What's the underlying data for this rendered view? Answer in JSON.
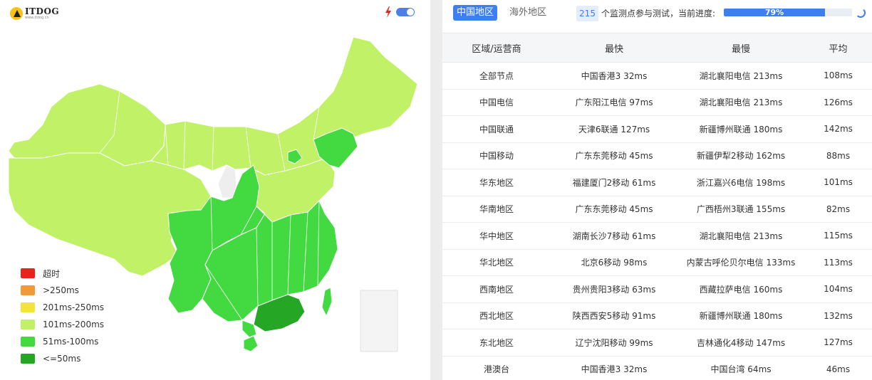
{
  "logo": {
    "title": "ITDOG",
    "subtitle": "www.itdog.cn"
  },
  "icons": {
    "flash": "flash-icon",
    "toggle": "toggle-switch",
    "spinner": "loading-spinner"
  },
  "colors": {
    "timeout": "#e8231c",
    "over250": "#f39a38",
    "r201_250": "#f3e43d",
    "r101_200": "#c0f166",
    "r51_100": "#43d940",
    "le50": "#25a725",
    "nodata": "#eeeeee",
    "accent": "#3d7ef0"
  },
  "legend": [
    {
      "label": "超时",
      "color": "#e8231c"
    },
    {
      "label": ">250ms",
      "color": "#f39a38"
    },
    {
      "label": "201ms-250ms",
      "color": "#f3e43d"
    },
    {
      "label": "101ms-200ms",
      "color": "#c0f166"
    },
    {
      "label": "51ms-100ms",
      "color": "#43d940"
    },
    {
      "label": "<=50ms",
      "color": "#25a725"
    }
  ],
  "tabs": {
    "china": "中国地区",
    "overseas": "海外地区"
  },
  "progress": {
    "count": "215",
    "text": "个监测点参与测试，当前进度:",
    "percent_label": "79%",
    "percent": 79
  },
  "table": {
    "headers": [
      "区域/运营商",
      "最快",
      "最慢",
      "平均"
    ],
    "rows": [
      [
        "全部节点",
        "中国香港3 32ms",
        "湖北襄阳电信 213ms",
        "108ms"
      ],
      [
        "中国电信",
        "广东阳江电信 97ms",
        "湖北襄阳电信 213ms",
        "126ms"
      ],
      [
        "中国联通",
        "天津6联通 127ms",
        "新疆博州联通 180ms",
        "142ms"
      ],
      [
        "中国移动",
        "广东东莞移动 45ms",
        "新疆伊犁2移动 162ms",
        "88ms"
      ],
      [
        "华东地区",
        "福建厦门2移动 61ms",
        "浙江嘉兴6电信 198ms",
        "101ms"
      ],
      [
        "华南地区",
        "广东东莞移动 45ms",
        "广西梧州3联通 155ms",
        "82ms"
      ],
      [
        "华中地区",
        "湖南长沙7移动 61ms",
        "湖北襄阳电信 213ms",
        "115ms"
      ],
      [
        "华北地区",
        "北京6移动 98ms",
        "内蒙古呼伦贝尔电信 133ms",
        "113ms"
      ],
      [
        "西南地区",
        "贵州贵阳3移动 63ms",
        "西藏拉萨电信 160ms",
        "104ms"
      ],
      [
        "西北地区",
        "陕西西安5移动 91ms",
        "新疆博州联通 180ms",
        "132ms"
      ],
      [
        "东北地区",
        "辽宁沈阳移动 99ms",
        "吉林通化4移动 147ms",
        "127ms"
      ],
      [
        "港澳台",
        "中国香港3 32ms",
        "中国台湾 64ms",
        "46ms"
      ]
    ]
  }
}
